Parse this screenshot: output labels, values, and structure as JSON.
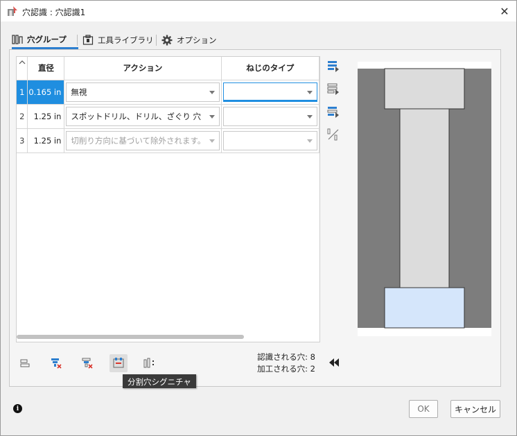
{
  "window": {
    "title": "穴認識 : 穴認識1"
  },
  "tabs": [
    {
      "label": "穴グループ",
      "icon": "hole-group-icon",
      "active": true
    },
    {
      "label": "工具ライブラリ",
      "icon": "tool-library-icon",
      "active": false
    },
    {
      "label": "オプション",
      "icon": "gear-icon",
      "active": false
    }
  ],
  "table": {
    "columns": [
      "",
      "直径",
      "アクション",
      "ねじのタイプ"
    ],
    "rows": [
      {
        "num": "1",
        "diameter": "0.165 in",
        "action": "無視",
        "thread": "",
        "selected": true,
        "disabled": false
      },
      {
        "num": "2",
        "diameter": "1.25 in",
        "action": "スポットドリル、ドリル、ざぐり 穴",
        "thread": "",
        "selected": false,
        "disabled": false
      },
      {
        "num": "3",
        "diameter": "1.25 in",
        "action": "切削り方向に基づいて除外されます。",
        "thread": "",
        "selected": false,
        "disabled": true
      }
    ]
  },
  "tooltip": {
    "text": "分割穴シグニチャ"
  },
  "counts": {
    "recognized": "認識される穴: 8",
    "machined": "加工される穴: 2"
  },
  "buttons": {
    "ok": "OK",
    "cancel": "キャンセル"
  },
  "colors": {
    "accent": "#1f8ee0",
    "preview_dark": "#7d7d7d",
    "preview_light": "#dcdcdc",
    "preview_highlight": "#d5e6fb"
  }
}
